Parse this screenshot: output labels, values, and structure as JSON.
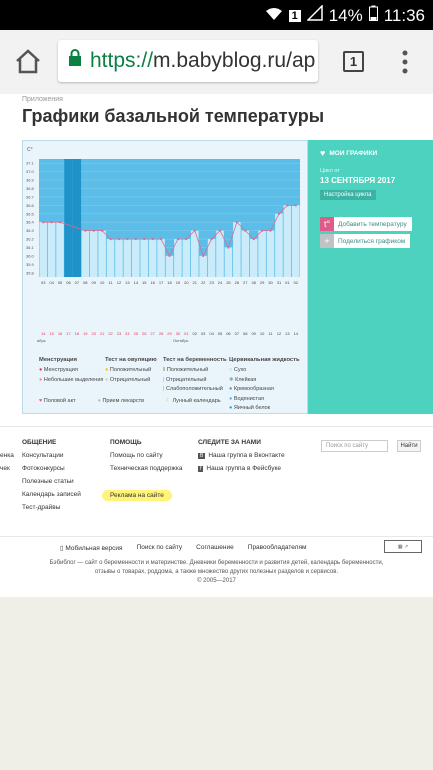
{
  "status_bar": {
    "battery": "14%",
    "time": "11:36"
  },
  "browser": {
    "url_scheme": "https://",
    "url_host": "m.babyblog.ru/ap",
    "tab_count": "1"
  },
  "page": {
    "breadcrumb": "Приложения",
    "title": "Графики базальной температуры"
  },
  "chart_data": {
    "type": "line",
    "ylabel": "C°",
    "y_ticks": [
      "37.1",
      "37.0",
      "36.9",
      "36.8",
      "36.7",
      "36.6",
      "36.5",
      "36.4",
      "36.3",
      "36.2",
      "36.1",
      "36.0",
      "35.9",
      "35.8"
    ],
    "ylim": [
      35.75,
      37.15
    ],
    "x": [
      "03",
      "04",
      "05",
      "06",
      "07",
      "08",
      "09",
      "10",
      "11",
      "12",
      "13",
      "14",
      "15",
      "16",
      "17",
      "18",
      "19",
      "20",
      "21",
      "22",
      "23",
      "24",
      "25",
      "26",
      "27",
      "28",
      "29",
      "30",
      "31",
      "01",
      "02"
    ],
    "values": [
      36.4,
      36.4,
      36.4,
      null,
      null,
      36.3,
      36.3,
      36.3,
      36.2,
      36.2,
      36.2,
      36.2,
      36.2,
      36.2,
      36.2,
      36.0,
      36.2,
      36.2,
      36.3,
      36.0,
      36.2,
      36.3,
      36.1,
      36.4,
      36.3,
      36.2,
      36.3,
      36.3,
      36.5,
      36.6,
      36.6
    ],
    "row_days": [
      "14",
      "15",
      "16",
      "17",
      "18",
      "19",
      "20",
      "21",
      "22",
      "23",
      "24",
      "25",
      "26",
      "27",
      "28",
      "29",
      "30",
      "01",
      "02",
      "03",
      "04",
      "05",
      "06",
      "07",
      "08",
      "09",
      "10",
      "11",
      "12",
      "13",
      "14",
      "15"
    ],
    "month_left": "ябрь",
    "month_right": "Октябрь",
    "grid": true
  },
  "legend": {
    "menstruation": {
      "title": "Менструация",
      "items": [
        "Менструация",
        "Небольшие выделения"
      ]
    },
    "ovulation": {
      "title": "Тест на овуляцию",
      "items": [
        "Положительный",
        "Отрицательный"
      ]
    },
    "pregnancy": {
      "title": "Тест на беременность",
      "items": [
        "Положительный",
        "Отрицательный",
        "Слабоположительный"
      ]
    },
    "cervical": {
      "title": "Цервикальная жидкость",
      "items": [
        "Сухо",
        "Клейкая",
        "Кремообразная",
        "Водянистая",
        "Яичный белок"
      ]
    },
    "bottom": [
      "Половой акт",
      "Прием лекарств",
      "Лунный календарь"
    ]
  },
  "sidebar": {
    "my_charts": "МОИ ГРАФИКИ",
    "cycle_label": "Цикл от",
    "cycle_date": "13 СЕНТЯБРЯ 2017",
    "settings": "Настройка цикла",
    "add_temp": "Добавить температуру",
    "share": "Поделиться графиком"
  },
  "footer": {
    "col1_title": "ОБЩЕНИЕ",
    "col1": [
      "Консультации",
      "Фотоконкурсы",
      "Полезные статьи",
      "Календарь записей",
      "Тест-драйвы"
    ],
    "col1_left": [
      "енка",
      "чек"
    ],
    "col2_title": "ПОМОЩЬ",
    "col2": [
      "Помощь по сайту",
      "Техническая поддержка",
      "Реклама на сайте"
    ],
    "col3_title": "СЛЕДИТЕ ЗА НАМИ",
    "col3": [
      "Наша группа в Вконтакте",
      "Наша группа в Фейсбуке"
    ],
    "search_placeholder": "Поиск по сайту",
    "search_button": "Найти",
    "links": [
      "Мобильная версия",
      "Поиск по сайту",
      "Соглашение",
      "Правообладателям"
    ],
    "about": "Бэбиблог — сайт о беременности и материнстве. Дневники беременности и развития детей, календарь беременности,",
    "about2": "отзывы о товарах, роддома, а также множество других полезных разделов и сервисов.",
    "copyright": "© 2005—2017"
  }
}
